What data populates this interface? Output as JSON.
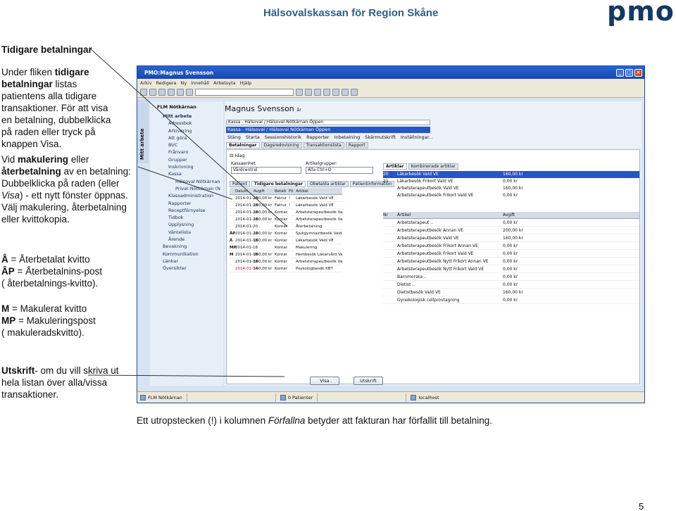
{
  "doc": {
    "header": "Hälsovalskassan för Region Skåne",
    "logo": "pmo",
    "heading": "Tidigare betalningar",
    "p1": {
      "t1": "Under fliken ",
      "t2": "tidigare",
      "t3": "betalningar",
      "t4": " listas patientens alla tidigare transaktioner. För att visa en betalning, dubbelklicka på raden eller tryck på knappen Visa."
    },
    "p2": {
      "t1": "Vid ",
      "t2": "makulering",
      "t3": " eller ",
      "t4": "återbetalning",
      "t5": " av en betalning: Dubbelklicka på raden (eller ",
      "t6": "Visa",
      "t7": ") - ett nytt fönster öppnas. Välj makulering, återbetalning eller kvittokopia."
    },
    "p3": {
      "l1a": "Å",
      "l1b": " = Återbetalat kvitto",
      "l2a": "ÅP",
      "l2b": " = Återbetalnins-post",
      "l3": "( återbetalnings-kvitto)."
    },
    "p4": {
      "l1a": "M",
      "l1b": " = Makulerat kvitto",
      "l2a": "MP",
      "l2b": " = Makuleringspost",
      "l3": "( makuleradskvitto)."
    },
    "p5": {
      "t1": "Utskrift",
      "t2": "- om du vill skriva ut hela listan över alla/vissa transaktioner."
    },
    "bottom": {
      "t1": "Ett utropstecken (!)  i kolumnen ",
      "t2": "Förfallna",
      "t3": " betyder att fakturan har förfallit till betalning."
    },
    "page_number": "5"
  },
  "app": {
    "title": "PMO:Magnus Svensson",
    "menu": [
      "Arkiv",
      "Redigera",
      "Ny",
      "Innehåll",
      "Arbetsyta",
      "Hjälp"
    ],
    "left_tab": "Mitt arbete",
    "unit": "FLM Nötkärnan",
    "nav_items": [
      "Mitt arbete",
      "Adressbok",
      "Arkivering",
      "Att göra",
      "BVC",
      "Frånvaro",
      "Grupper",
      "Inskrivning",
      "Kassa",
      "Hälsoval Nötkärnan",
      "Privat Nötkärnan (N",
      "Klassadministration",
      "Rapporter",
      "Receptförnyelse",
      "Tidbok",
      "Upplysning",
      "Väntelista",
      "Ärende",
      "Bevakning",
      "Kommunikation",
      "Länkar",
      "Översikter"
    ],
    "patient_name": "Magnus Svensson",
    "patient_age": "år",
    "kassa_bar1": "Kassa - Hälsoval / Hälsoval Nötkärnan Öppen",
    "kassa_bar2": "Kassa - Hälsoval / Hälsoval Nötkärnan Öppen",
    "kassa_menu": [
      "Stäng",
      "Starta",
      "Sessionshistorik",
      "Rapporter",
      "Inbetalning",
      "Skärmutskrift",
      "Inställningar..."
    ],
    "tabs1": [
      "Betalningar",
      "Dagsredovisning",
      "Transaktionslista",
      "Rapport"
    ],
    "today": "Idag",
    "kassaenhet_label": "Kassaenhet",
    "kassaenhet_value": "Vårdcentral",
    "artgrupper_label": "Artikelgrupper:",
    "artgrupper_value": "Alla Ctrl+O",
    "tabs2": [
      "Patient",
      "Tidigare betalningar",
      "Obetalda artiklar",
      "Patientinformation"
    ],
    "tabs3": [
      "Artiklar",
      "Kombinerade artiklar"
    ],
    "pay_headers": [
      "",
      "Datum",
      "Avgift",
      "Betalt",
      "Fö",
      "Artikel"
    ],
    "pay_rows": [
      {
        "code": "",
        "date": "2014-01-20",
        "fee": "160,00 kr",
        "paid": "Faktur",
        "flag": "!",
        "art": "Läkarbesök Vald VE",
        "red": false
      },
      {
        "code": "",
        "date": "2014-01-20",
        "fee": "160,00 kr",
        "paid": "Faktur",
        "flag": "!",
        "art": "Läkarbesök Vald VE",
        "red": false
      },
      {
        "code": "",
        "date": "2014-01-20",
        "fee": "160,00 kr",
        "paid": "Kontar",
        "flag": "",
        "art": "Arbetsterapeutbesök Vald VE",
        "red": false
      },
      {
        "code": "",
        "date": "2014-01-20",
        "fee": "160,00 kr",
        "paid": "Kontar",
        "flag": "",
        "art": "Arbetsterapeutbesök Vald VE",
        "red": false
      },
      {
        "code": "",
        "date": "2014-01-20",
        "fee": "",
        "paid": "Kontar",
        "flag": "",
        "art": "Återbetalning",
        "red": false
      },
      {
        "code": "ÅP",
        "date": "2014-01-20",
        "fee": "160,00 kr",
        "paid": "Kontar",
        "flag": "",
        "art": "Sjukgymnastbesök Vald VE",
        "red": false
      },
      {
        "code": "Å",
        "date": "2014-01-18",
        "fee": "160,00 kr",
        "paid": "Kontar",
        "flag": "",
        "art": "Läkarbesök Vald VE",
        "red": false
      },
      {
        "code": "MP",
        "date": "2014-01-18",
        "fee": "",
        "paid": "Kontar",
        "flag": "",
        "art": "Makulering",
        "red": false
      },
      {
        "code": "M",
        "date": "2014-01-18",
        "fee": "260,00 kr",
        "paid": "Kontar",
        "flag": "",
        "art": "Hembesök Läkarvård Vald VE",
        "red": false
      },
      {
        "code": "",
        "date": "2014-01-18",
        "fee": "160,00 kr",
        "paid": "Kontar",
        "flag": "",
        "art": "Arbetsterapeutbesök Vald VE",
        "red": false
      },
      {
        "code": "",
        "date": "2014-01-14",
        "fee": "160,00 kr",
        "paid": "Kontar",
        "flag": "",
        "art": "Psykologbesök KBT",
        "red": true
      }
    ],
    "art_top_rows": [
      {
        "n": "20",
        "name": "Läkarbesök Vald VE",
        "price": "160,00 kr",
        "sel": true
      },
      {
        "n": "21",
        "name": "Läkarbesök Frikort Vald VE",
        "price": "0,00 kr",
        "sel": false
      },
      {
        "n": "",
        "name": "Arbetsterapeutbesök Vald VE",
        "price": "160,00 kr",
        "sel": false
      },
      {
        "n": "",
        "name": "Arbetsterapeutbesök Frikort Vald VE",
        "price": "0,00 kr",
        "sel": false
      }
    ],
    "art_bot_headers": [
      "Nr",
      "Artikel",
      "Avgift",
      ""
    ],
    "art_bot_rows": [
      {
        "name": "Arbetsterapeut ..",
        "price": "0,00 kr"
      },
      {
        "name": "Arbetsterapeutbesök Annan VE",
        "price": "200,00 kr"
      },
      {
        "name": "Arbetsterapeutbesök Vald VE",
        "price": "160,00 kr"
      },
      {
        "name": "Arbetsterapeutbesök Frikort Annan VE",
        "price": "0,00 kr"
      },
      {
        "name": "Arbetsterapeutbesök Frikort Vald VE",
        "price": "0,00 kr"
      },
      {
        "name": "Arbetsterapeutbesök Nytt Frikort Annan VE",
        "price": "0,00 kr"
      },
      {
        "name": "Arbetsterapeutbesök Nytt Frikort Vald VE",
        "price": "0,00 kr"
      },
      {
        "name": "Barnmorska ..",
        "price": "0,00 kr"
      },
      {
        "name": "Dietist ..",
        "price": "0,00 kr"
      },
      {
        "name": "Dietistbesök Vald VE",
        "price": "160,00 kr"
      },
      {
        "name": "Gynekologisk cellprovtagning",
        "price": "0,00 kr"
      }
    ],
    "btn_visa": "Visa",
    "btn_utskrift": "Utskrift",
    "status": {
      "unit": "FLM Nötkärnan",
      "patients": "0 Patienter",
      "host": "localhost"
    }
  }
}
